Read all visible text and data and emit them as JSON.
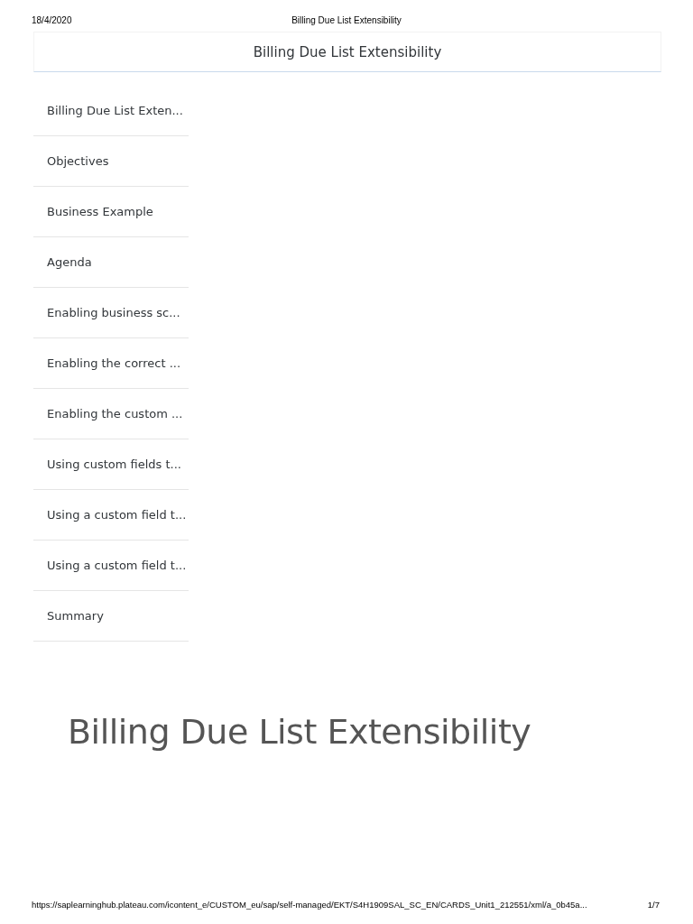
{
  "print_header": {
    "date": "18/4/2020",
    "title": "Billing Due List Extensibility"
  },
  "header": {
    "title": "Billing Due List Extensibility"
  },
  "nav": {
    "items": [
      {
        "label": "Billing Due List Exten..."
      },
      {
        "label": "Objectives"
      },
      {
        "label": "Business Example"
      },
      {
        "label": "Agenda"
      },
      {
        "label": "Enabling business sc..."
      },
      {
        "label": "Enabling the correct ..."
      },
      {
        "label": "Enabling the custom ..."
      },
      {
        "label": "Using custom fields t..."
      },
      {
        "label": "Using a custom field t..."
      },
      {
        "label": "Using a custom field t..."
      },
      {
        "label": "Summary"
      }
    ]
  },
  "content": {
    "heading": "Billing Due List Extensibility"
  },
  "print_footer": {
    "url": "https://saplearninghub.plateau.com/icontent_e/CUSTOM_eu/sap/self-managed/EKT/S4H1909SAL_SC_EN/CARDS_Unit1_212551/xml/a_0b45a...",
    "page": "1/7"
  }
}
